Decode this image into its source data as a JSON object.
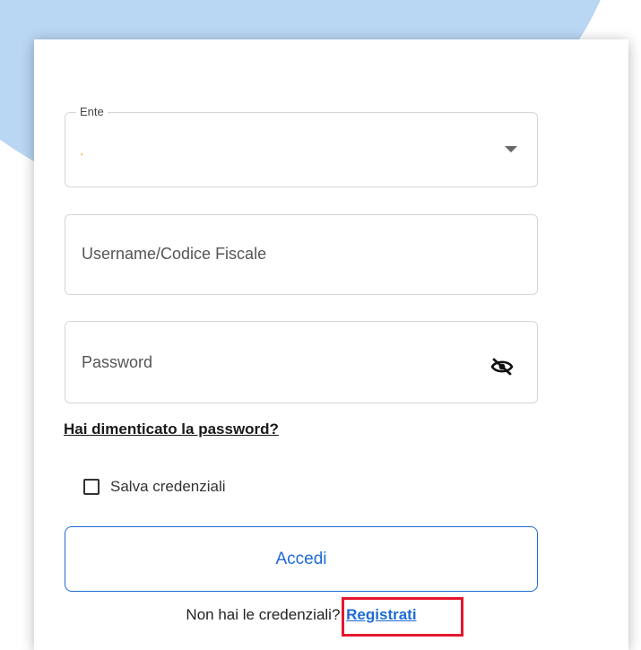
{
  "form": {
    "ente": {
      "label": "Ente",
      "value": "."
    },
    "username": {
      "placeholder": "Username/Codice Fiscale"
    },
    "password": {
      "placeholder": "Password",
      "toggle_icon": "eye-slash-icon"
    },
    "forgot_password_label": "Hai dimenticato la password?",
    "remember": {
      "label": "Salva credenziali",
      "checked": false
    },
    "login_label": "Accedi",
    "register_prompt": "Non hai le credenziali?",
    "register_label": "Registrati"
  },
  "colors": {
    "accent": "#1e6bd6",
    "highlight": "#e5172f",
    "background_shape": "#b9d6f2"
  }
}
